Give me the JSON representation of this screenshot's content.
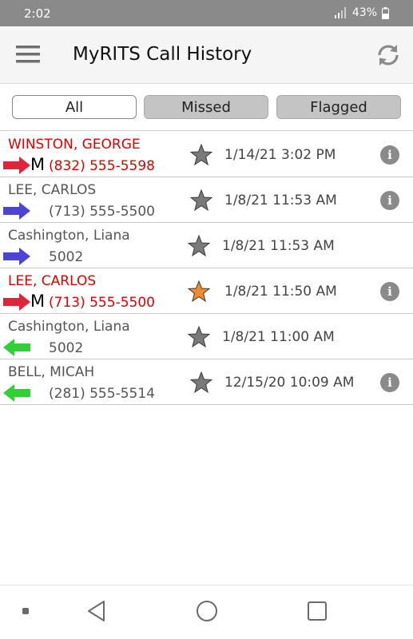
{
  "status_bar": {
    "time": "2:02",
    "battery": "43%"
  },
  "app": {
    "title": "MyRITS Call History"
  },
  "filters": {
    "all": "All",
    "missed": "Missed",
    "flagged": "Flagged",
    "selected": "All"
  },
  "calls": [
    {
      "name": "WINSTON, GEORGE",
      "number": "(832) 555-5598",
      "time": "1/14/21 3:02 PM",
      "direction": "outgoing",
      "missed": true,
      "voicemail": "M",
      "flagged": false,
      "info": true
    },
    {
      "name": "LEE, CARLOS",
      "number": "(713) 555-5500",
      "time": "1/8/21 11:53 AM",
      "direction": "outgoing",
      "missed": false,
      "voicemail": "",
      "flagged": false,
      "info": true
    },
    {
      "name": "Cashington, Liana",
      "number": "5002",
      "time": "1/8/21 11:53 AM",
      "direction": "outgoing",
      "missed": false,
      "voicemail": "",
      "flagged": false,
      "info": false
    },
    {
      "name": "LEE, CARLOS",
      "number": "(713) 555-5500",
      "time": "1/8/21 11:50 AM",
      "direction": "outgoing",
      "missed": true,
      "voicemail": "M",
      "flagged": true,
      "info": true
    },
    {
      "name": "Cashington,  Liana",
      "number": "5002",
      "time": "1/8/21 11:00 AM",
      "direction": "incoming",
      "missed": false,
      "voicemail": "",
      "flagged": false,
      "info": false
    },
    {
      "name": "BELL, MICAH",
      "number": "(281) 555-5514",
      "time": "12/15/20 10:09 AM",
      "direction": "incoming",
      "missed": false,
      "voicemail": "",
      "flagged": false,
      "info": true
    }
  ],
  "colors": {
    "missed_text": "#e00000",
    "missed_arrow": "#e0243a",
    "outgoing_arrow": "#4b45d0",
    "incoming_arrow": "#2fd135",
    "flag_star": "#f28a2e",
    "star": "#7a7a7a",
    "status_bar": "#8a8a8a"
  }
}
